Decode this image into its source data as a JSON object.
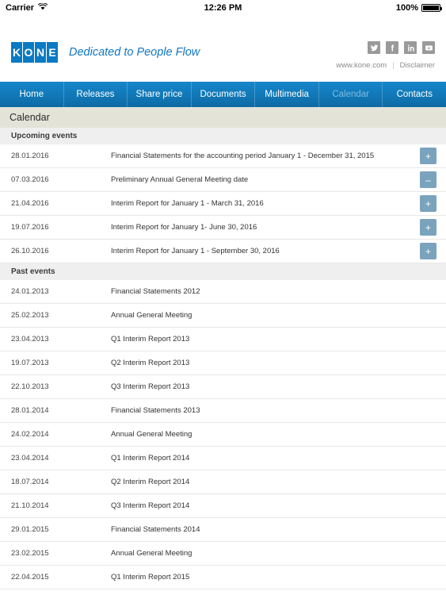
{
  "status_bar": {
    "carrier": "Carrier",
    "wifi_icon": "wifi-icon",
    "time": "12:26 PM",
    "battery_percent": "100%",
    "battery_icon": "battery-full-icon"
  },
  "header": {
    "logo_letters": [
      "K",
      "O",
      "N",
      "E"
    ],
    "logo_color": "#0a7ac4",
    "tagline": "Dedicated to People Flow",
    "socials": [
      {
        "name": "twitter-icon",
        "label": "Twitter"
      },
      {
        "name": "facebook-icon",
        "label": "Facebook"
      },
      {
        "name": "linkedin-icon",
        "label": "LinkedIn"
      },
      {
        "name": "youtube-icon",
        "label": "YouTube"
      }
    ],
    "website_link": "www.kone.com",
    "separator": "|",
    "disclaimer_link": "Disclaimer"
  },
  "nav": {
    "active_index": 5,
    "items": [
      {
        "label": "Home"
      },
      {
        "label": "Releases"
      },
      {
        "label": "Share price"
      },
      {
        "label": "Documents"
      },
      {
        "label": "Multimedia"
      },
      {
        "label": "Calendar"
      },
      {
        "label": "Contacts"
      }
    ]
  },
  "page": {
    "title": "Calendar"
  },
  "sections": [
    {
      "heading": "Upcoming events",
      "events": [
        {
          "date": "28.01.2016",
          "title": "Financial Statements for the accounting period January 1 - December 31, 2015",
          "button": "+"
        },
        {
          "date": "07.03.2016",
          "title": "Preliminary Annual General Meeting date",
          "button": "–"
        },
        {
          "date": "21.04.2016",
          "title": "Interim Report for January 1 - March 31, 2016",
          "button": "+"
        },
        {
          "date": "19.07.2016",
          "title": "Interim Report for January 1- June 30, 2016",
          "button": "+"
        },
        {
          "date": "26.10.2016",
          "title": "Interim Report for January 1 - September 30, 2016",
          "button": "+"
        }
      ]
    },
    {
      "heading": "Past events",
      "events": [
        {
          "date": "24.01.2013",
          "title": "Financial Statements 2012",
          "button": ""
        },
        {
          "date": "25.02.2013",
          "title": "Annual General Meeting",
          "button": ""
        },
        {
          "date": "23.04.2013",
          "title": "Q1 Interim Report 2013",
          "button": ""
        },
        {
          "date": "19.07.2013",
          "title": "Q2 Interim Report 2013",
          "button": ""
        },
        {
          "date": "22.10.2013",
          "title": "Q3 Interim Report 2013",
          "button": ""
        },
        {
          "date": "28.01.2014",
          "title": "Financial Statements 2013",
          "button": ""
        },
        {
          "date": "24.02.2014",
          "title": "Annual General Meeting",
          "button": ""
        },
        {
          "date": "23.04.2014",
          "title": "Q1 Interim Report 2014",
          "button": ""
        },
        {
          "date": "18.07.2014",
          "title": "Q2 Interim Report 2014",
          "button": ""
        },
        {
          "date": "21.10.2014",
          "title": "Q3 Interim Report 2014",
          "button": ""
        },
        {
          "date": "29.01.2015",
          "title": "Financial Statements 2014",
          "button": ""
        },
        {
          "date": "23.02.2015",
          "title": "Annual General Meeting",
          "button": ""
        },
        {
          "date": "22.04.2015",
          "title": "Q1 Interim Report 2015",
          "button": ""
        }
      ]
    }
  ],
  "colors": {
    "brand_blue": "#0a7ac4",
    "nav_blue": "#1178b7",
    "title_bar": "#e4e3d8",
    "section_bar": "#efefef",
    "action_button": "#7aa3bd"
  }
}
